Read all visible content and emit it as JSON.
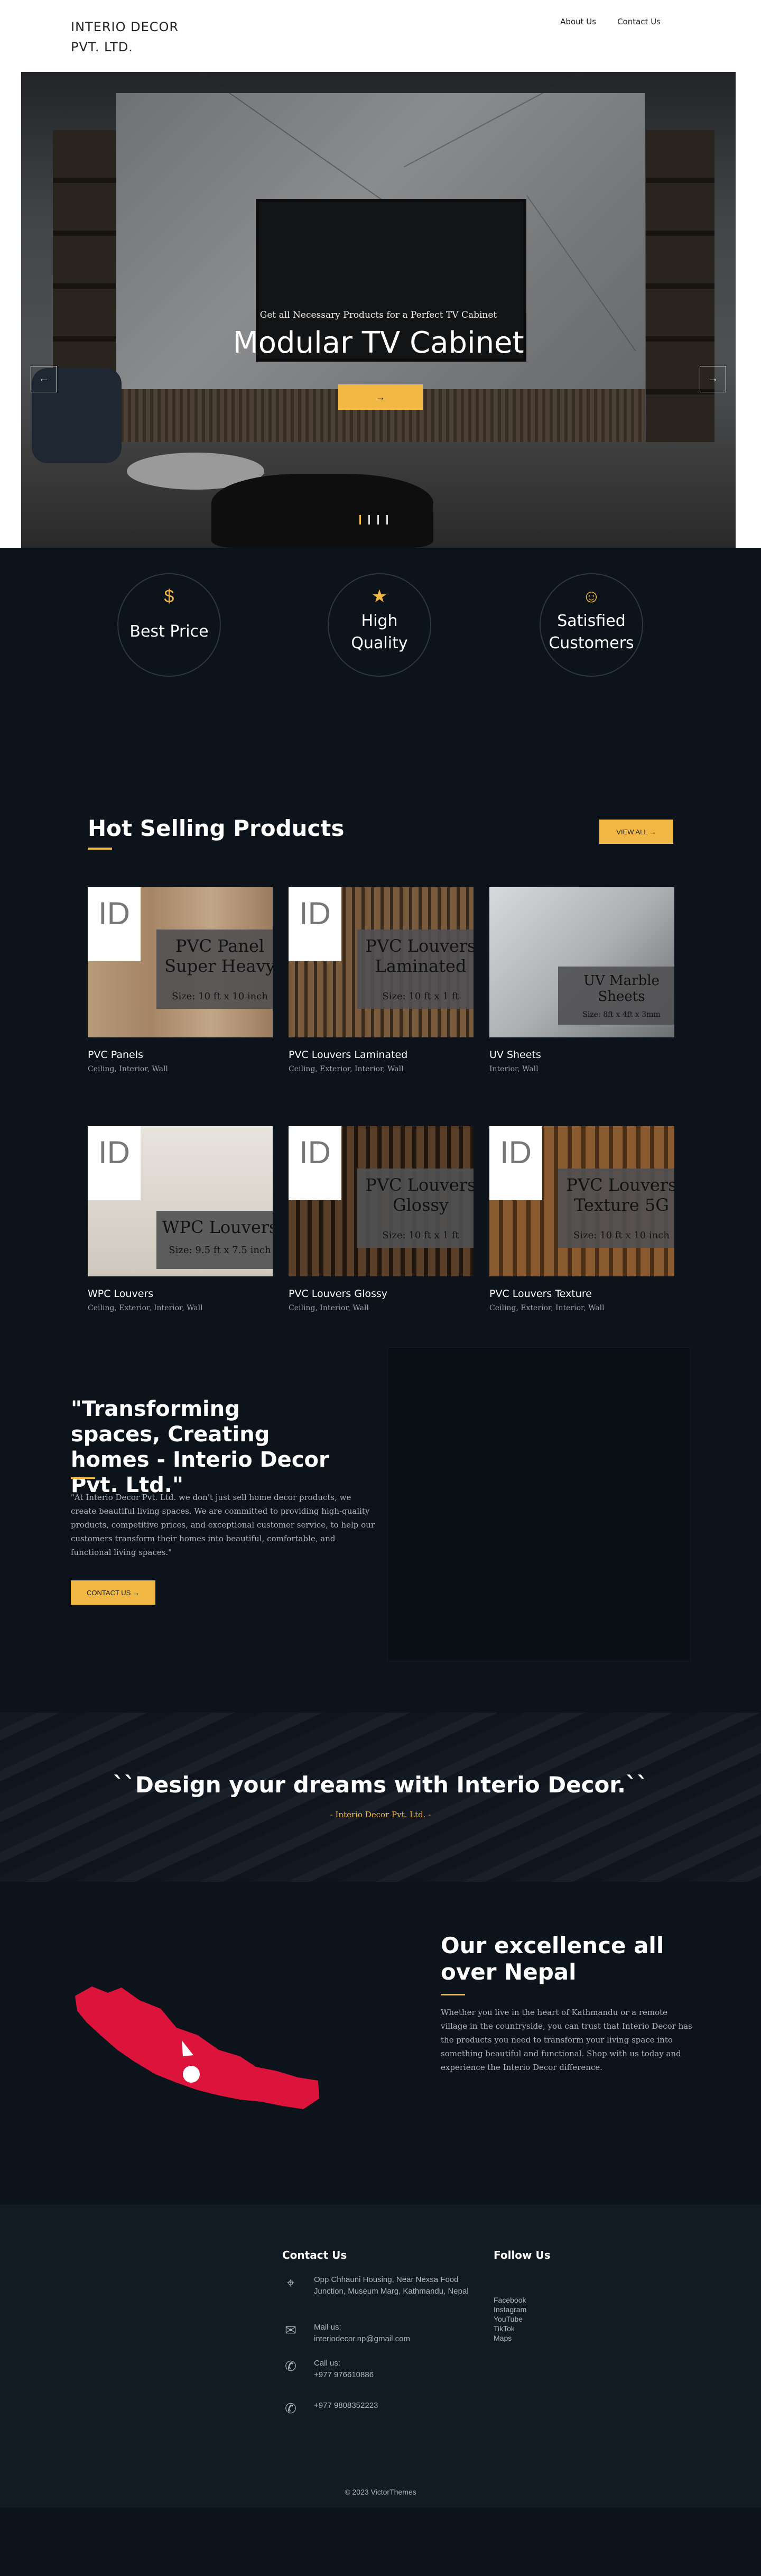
{
  "header": {
    "logo": "INTERIO DECOR PVT. LTD.",
    "nav": [
      "About Us",
      "Contact Us"
    ]
  },
  "hero": {
    "subtitle": "Get all Necessary Products for a Perfect TV Cabinet",
    "title": "Modular TV Cabinet",
    "button": "→",
    "prev": "←",
    "next": "→",
    "active_slide": 1,
    "slide_count": 4
  },
  "features": [
    {
      "icon": "best-price-icon",
      "glyph": "$",
      "label": "Best Price"
    },
    {
      "icon": "medal-icon",
      "glyph": "★",
      "label": "High Quality"
    },
    {
      "icon": "handshake-icon",
      "glyph": "☺",
      "label": "Satisfied Customers"
    }
  ],
  "products": {
    "title": "Hot Selling Products",
    "view_all": "VIEW ALL →",
    "items": [
      {
        "name": "PVC Panels",
        "tags": "Ceiling, Interior, Wall",
        "panel": "PVC Panel Super Heavy",
        "size": "Size: 10 ft x 10 inch",
        "bg": "bg-wood",
        "logo": "ID"
      },
      {
        "name": "PVC Louvers Laminated",
        "tags": "Ceiling, Exterior, Interior, Wall",
        "panel": "PVC Louvers Laminated",
        "size": "Size: 10 ft x 1 ft",
        "bg": "bg-slat",
        "logo": "ID"
      },
      {
        "name": "UV Sheets",
        "tags": "Interior, Wall",
        "panel": "UV Marble Sheets",
        "size": "Size: 8ft x 4ft x 3mm",
        "bg": "bg-marble",
        "logo": ""
      },
      {
        "name": "WPC Louvers",
        "tags": "Ceiling, Exterior, Interior, Wall",
        "panel": "WPC Louvers",
        "size": "Size: 9.5 ft x 7.5 inch",
        "bg": "bg-room",
        "logo": "ID"
      },
      {
        "name": "PVC Louvers Glossy",
        "tags": "Ceiling, Interior, Wall",
        "panel": "PVC Louvers Glossy",
        "size": "Size: 10 ft x 1 ft",
        "bg": "bg-dark",
        "logo": "ID"
      },
      {
        "name": "PVC Louvers Texture",
        "tags": "Ceiling, Exterior, Interior, Wall",
        "panel": "PVC Louvers Texture 5G",
        "size": "Size: 10 ft x 10 inch",
        "bg": "bg-tex",
        "logo": "ID"
      }
    ]
  },
  "about": {
    "quote": "\"Transforming spaces, Creating homes - Interio Decor Pvt. Ltd.\"",
    "text": "\"At Interio Decor Pvt. Ltd. we don't just sell home decor products, we create beautiful living spaces. We are committed to providing high-quality products, competitive prices, and exceptional customer service, to help our customers transform their homes into beautiful, comfortable, and functional living spaces.\"",
    "button": "CONTACT US →"
  },
  "banner": {
    "title": "``Design your dreams with Interio Decor.``",
    "subtitle": "- Interio Decor Pvt. Ltd. -"
  },
  "nepal": {
    "title": "Our excellence all over Nepal",
    "text": "Whether you live in the heart of Kathmandu or a remote village in the countryside, you can trust that Interio Decor has the products you need to transform your living space into something beautiful and functional. Shop with us today and experience the Interio Decor difference."
  },
  "footer": {
    "contact_title": "Contact Us",
    "follow_title": "Follow Us",
    "address": "Opp Chhauni Housing, Near Nexsa Food Junction, Museum Marg, Kathmandu, Nepal",
    "mail_label": "Mail us:",
    "mail": "interiodecor.np@gmail.com",
    "call_label": "Call us:",
    "phone1": "+977 976610886",
    "phone2": "+977 9808352223",
    "social": [
      "Facebook",
      "Instagram",
      "YouTube",
      "TikTok",
      "Maps"
    ],
    "copyright": "© 2023 VictorThemes"
  },
  "colors": {
    "accent": "#f1b843",
    "background": "#0d131b",
    "nepal_red": "#dc143c"
  }
}
